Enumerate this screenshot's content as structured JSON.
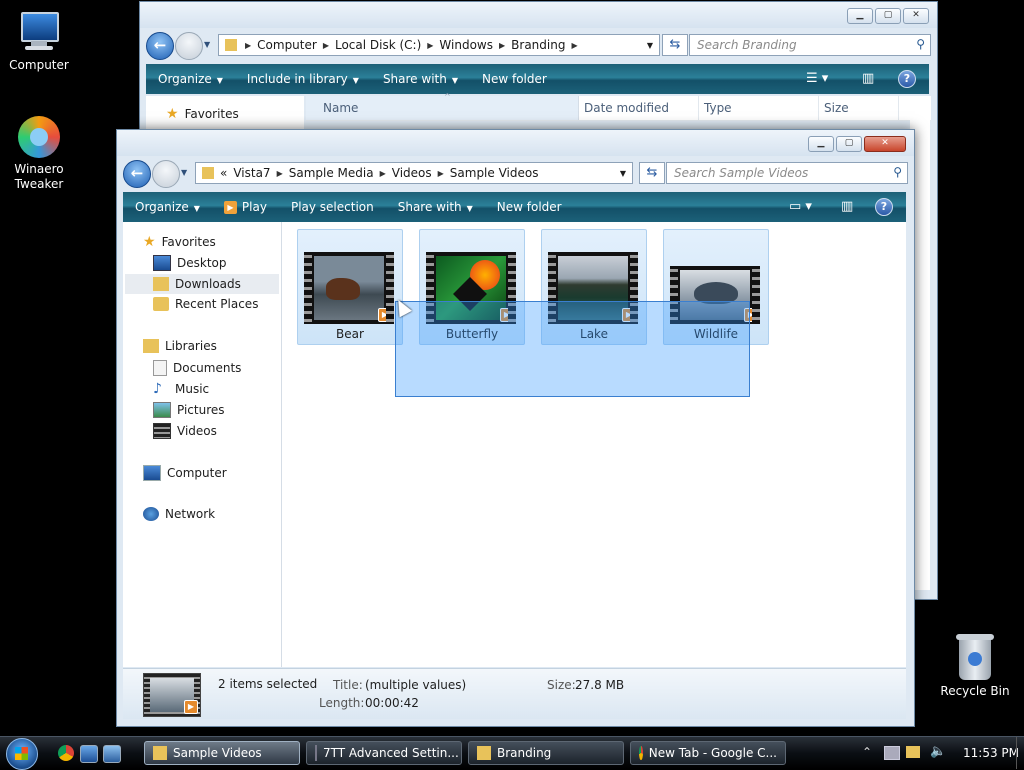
{
  "desktop": {
    "icons": [
      {
        "label": "Computer"
      },
      {
        "label": "Winaero Tweaker"
      },
      {
        "label": "Recycle Bin"
      }
    ]
  },
  "back_window": {
    "breadcrumb": [
      "Computer",
      "Local Disk (C:)",
      "Windows",
      "Branding"
    ],
    "search_placeholder": "Search Branding",
    "toolbar": [
      "Organize",
      "Include in library",
      "Share with",
      "New folder"
    ],
    "nav_favorites": "Favorites",
    "columns": [
      "Name",
      "Date modified",
      "Type",
      "Size"
    ]
  },
  "front_window": {
    "breadcrumb_prefix": "«",
    "breadcrumb": [
      "Vista7",
      "Sample Media",
      "Videos",
      "Sample Videos"
    ],
    "search_placeholder": "Search Sample Videos",
    "toolbar": {
      "organize": "Organize",
      "play": "Play",
      "play_selection": "Play selection",
      "share_with": "Share with",
      "new_folder": "New folder"
    },
    "nav": {
      "favorites": "Favorites",
      "desktop": "Desktop",
      "downloads": "Downloads",
      "recent": "Recent Places",
      "libraries": "Libraries",
      "documents": "Documents",
      "music": "Music",
      "pictures": "Pictures",
      "videos": "Videos",
      "computer": "Computer",
      "network": "Network"
    },
    "files": [
      {
        "name": "Bear",
        "selected": true
      },
      {
        "name": "Butterfly",
        "selected": true
      },
      {
        "name": "Lake",
        "selected": true
      },
      {
        "name": "Wildlife",
        "selected": true
      }
    ],
    "details": {
      "count": "2 items selected",
      "title_label": "Title:",
      "title_value": "(multiple values)",
      "length_label": "Length:",
      "length_value": "00:00:42",
      "size_label": "Size:",
      "size_value": "27.8 MB"
    }
  },
  "taskbar": {
    "tasks": [
      {
        "label": "Sample Videos",
        "active": true
      },
      {
        "label": "7TT Advanced Settin...",
        "active": false
      },
      {
        "label": "Branding",
        "active": false
      },
      {
        "label": "New Tab - Google C...",
        "active": false
      }
    ],
    "clock": "11:53 PM"
  },
  "colors": {
    "command_bar": "#1c6179",
    "selection": "#3399ff",
    "desktop": "#000000"
  }
}
